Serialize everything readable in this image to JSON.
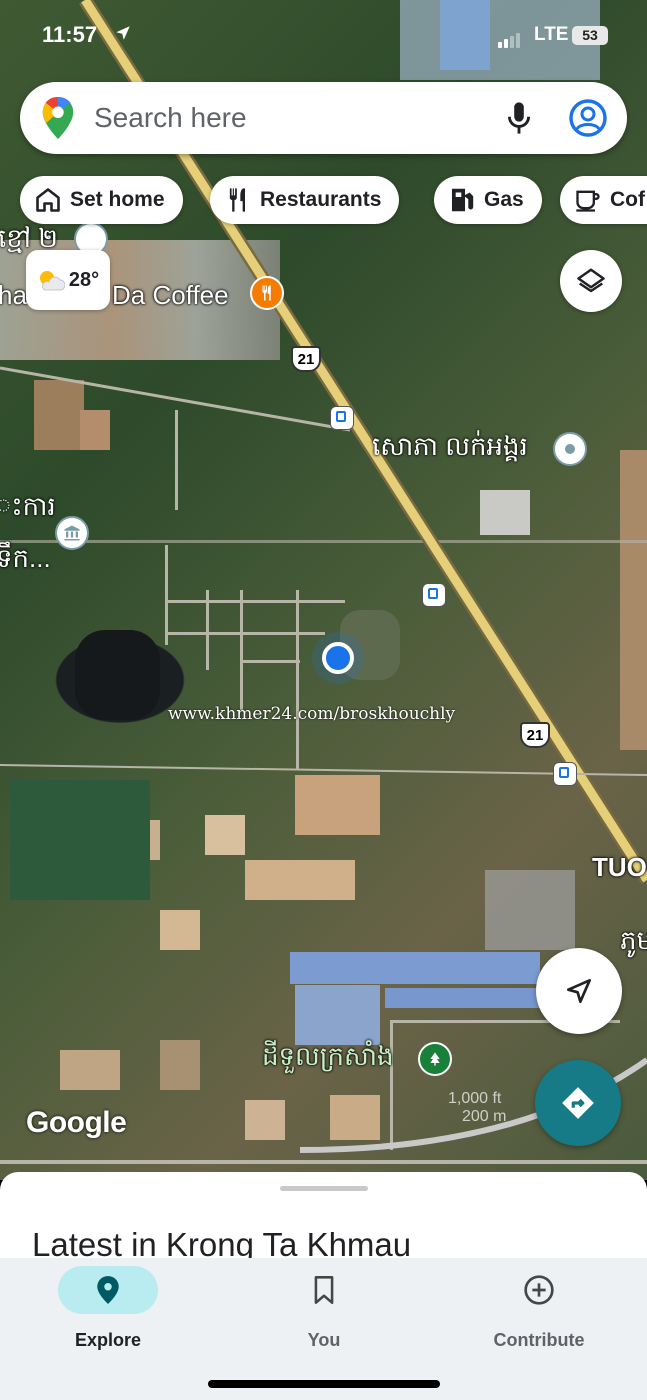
{
  "status_bar": {
    "time": "11:57",
    "network": "LTE",
    "battery": "53"
  },
  "search": {
    "placeholder": "Search here"
  },
  "chips": [
    {
      "label": "Set home",
      "icon": "home-icon"
    },
    {
      "label": "Restaurants",
      "icon": "fork-knife-icon"
    },
    {
      "label": "Gas",
      "icon": "gas-pump-icon"
    },
    {
      "label": "Cof",
      "icon": "coffee-icon"
    }
  ],
  "weather": {
    "temp": "28°",
    "icon": "partly-cloudy-icon"
  },
  "map": {
    "labels": [
      {
        "text": "ខ្មៅ ២"
      },
      {
        "text": "ha"
      },
      {
        "text": "Da Coffee"
      },
      {
        "text": "សោភា លក់អង្គរ"
      },
      {
        "text": "ះការ"
      },
      {
        "text": "ទឹក..."
      },
      {
        "text": "TUO"
      },
      {
        "text": "ភូម"
      },
      {
        "text": "ដីទួលក្រសាំង"
      }
    ],
    "route_shields": [
      "21",
      "21"
    ],
    "watermark": "www.khmer24.com/broskhouchly",
    "attribution": "Google",
    "scale": [
      "1,000 ft",
      "200 m"
    ],
    "colors": {
      "road": "#e5cf78",
      "restaurant_poi": "#f57c00",
      "park_poi": "#188038",
      "my_location": "#1a73e8",
      "directions": "#167b86"
    }
  },
  "sheet": {
    "title": "Latest in Krong Ta Khmau"
  },
  "nav": [
    {
      "label": "Explore",
      "icon": "explore-pin-icon",
      "active": true
    },
    {
      "label": "You",
      "icon": "bookmark-icon",
      "active": false
    },
    {
      "label": "Contribute",
      "icon": "add-circle-icon",
      "active": false
    }
  ]
}
